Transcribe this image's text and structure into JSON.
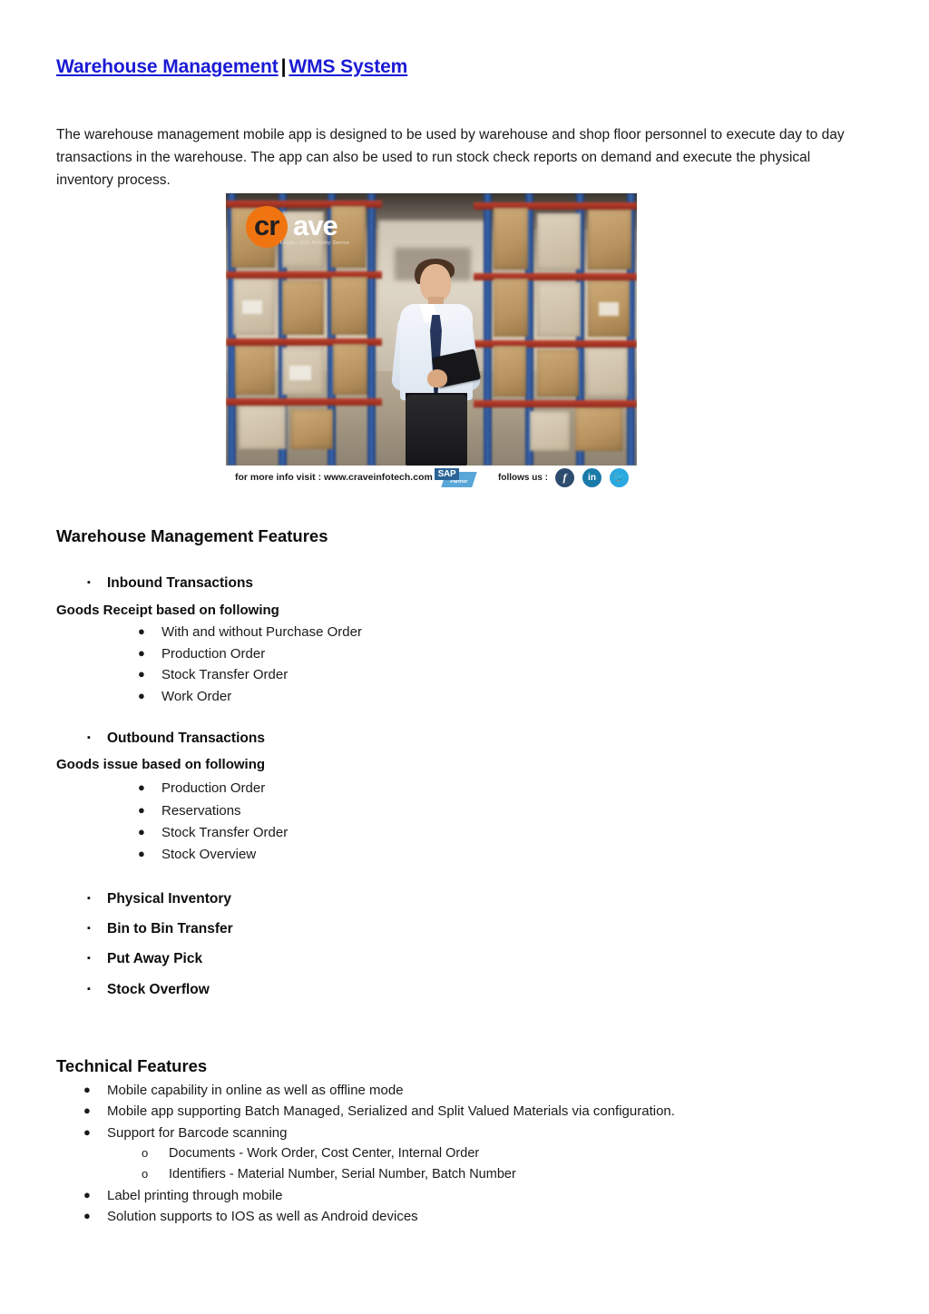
{
  "document": {
    "title": {
      "link1": "Warehouse Management",
      "separator": "|",
      "link2": "WMS System",
      "link_color": "#1a1ad6"
    },
    "intro": "The warehouse management mobile app is designed to be used by warehouse and shop floor personnel to execute day to day transactions in the warehouse. The app can also be used to run stock check reports on demand and execute the physical inventory process."
  },
  "promo_image": {
    "alt": "Warehouse worker with clipboard standing in a warehouse aisle",
    "logo": {
      "mark_text": "cr",
      "word_text": "ave",
      "tagline": "Leader With Mobility Device",
      "mark_color": "#f07511"
    },
    "footer": {
      "info_text": "for more info visit : www.craveinfotech.com",
      "partner_badge_main": "SAP",
      "partner_badge_sub": "Partner",
      "follow_text": "follows us :",
      "social": [
        {
          "name": "facebook",
          "glyph": "f"
        },
        {
          "name": "linkedin",
          "glyph": "in"
        },
        {
          "name": "twitter",
          "glyph": "🐦"
        }
      ]
    }
  },
  "features": {
    "heading": "Warehouse Management Features",
    "inbound": {
      "bullet": "▪",
      "label": "Inbound Transactions",
      "sub_heading": "Goods Receipt based on following",
      "items": [
        "With and without Purchase Order",
        "Production Order",
        "Stock Transfer Order",
        "Work Order"
      ]
    },
    "outbound": {
      "bullet": "▪",
      "label": "Outbound Transactions",
      "sub_heading": "Goods issue based on following",
      "items": [
        "Production Order",
        "Reservations",
        "Stock Transfer Order",
        "Stock Overview"
      ]
    },
    "other": [
      "Physical Inventory",
      "Bin to Bin Transfer",
      "Put Away Pick",
      "Stock Overflow"
    ],
    "bullet_round": "●"
  },
  "technical": {
    "heading": "Technical Features",
    "bullet_round": "●",
    "bullet_hollow": "o",
    "items": [
      "Mobile capability in online as well as offline mode",
      "Mobile app supporting Batch Managed, Serialized and Split Valued Materials via configuration.",
      "Support for Barcode scanning"
    ],
    "sub_items": [
      "Documents - Work Order, Cost Center, Internal Order",
      "Identifiers - Material Number, Serial Number, Batch Number"
    ],
    "items_tail": [
      "Label printing through mobile",
      "Solution supports to IOS as well as Android devices"
    ]
  }
}
